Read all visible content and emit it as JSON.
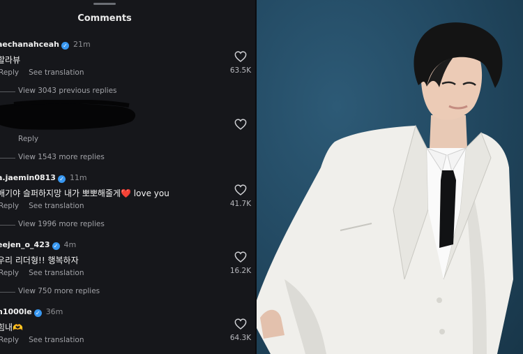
{
  "comments_panel": {
    "title": "Comments",
    "comments": [
      {
        "username": "aechanahceah",
        "time": "21m",
        "text": "할라뷰",
        "reply": "Reply",
        "see_translation": "See translation",
        "likes": "63.5K",
        "more_replies": "View 3043 previous replies"
      },
      {
        "username": "",
        "time": "",
        "text": "",
        "reply": "Reply",
        "likes": "",
        "more_replies": "View 1543 more replies"
      },
      {
        "username": "a.jaemin0813",
        "time": "11m",
        "text": "애기야 슬퍼하지망 내가 뽀뽀해줄게❤️ love you",
        "reply": "Reply",
        "see_translation": "See translation",
        "likes": "41.7K",
        "more_replies": "View 1996 more replies"
      },
      {
        "username": "eejen_o_423",
        "time": "4m",
        "text": "우리 리더형!! 행복하자",
        "reply": "Reply",
        "see_translation": "See translation",
        "likes": "16.2K",
        "more_replies": "View 750 more replies"
      },
      {
        "username": "h1000le",
        "time": "36m",
        "text": "힘내🫶",
        "reply": "Reply",
        "see_translation": "See translation",
        "likes": "64.3K"
      }
    ]
  },
  "colors": {
    "panel_bg": "#16171b",
    "verified": "#3897f0",
    "photo_bg": "#234a63",
    "suit": "#f2f1ee"
  },
  "icons": [
    "heart-icon",
    "verified-badge-icon"
  ]
}
